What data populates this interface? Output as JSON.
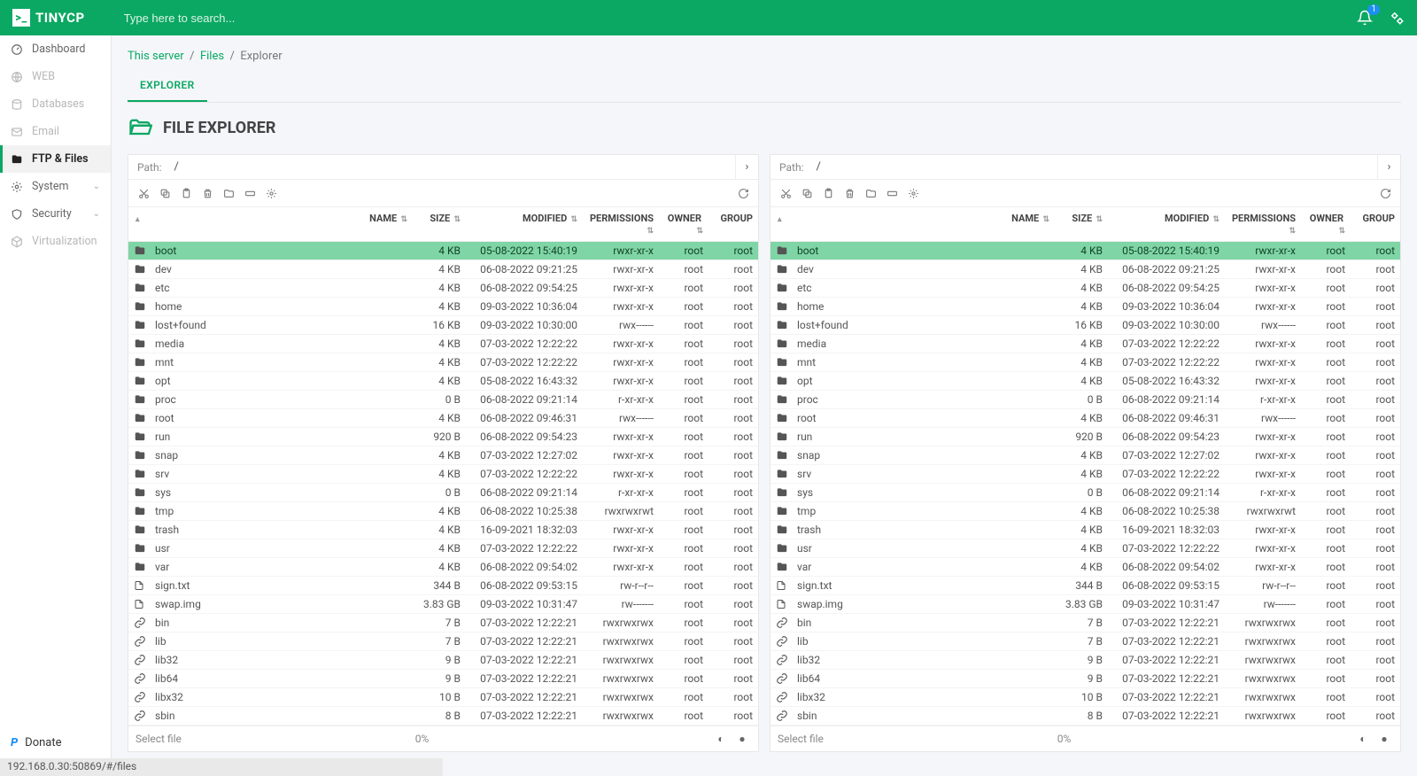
{
  "brand": "TINYCP",
  "search": {
    "placeholder": "Type here to search..."
  },
  "notifications": {
    "count": "1"
  },
  "sidebar": {
    "items": [
      {
        "label": "Dashboard",
        "muted": false,
        "chevron": false,
        "icon": "gauge"
      },
      {
        "label": "WEB",
        "muted": true,
        "chevron": false,
        "icon": "globe"
      },
      {
        "label": "Databases",
        "muted": true,
        "chevron": false,
        "icon": "db"
      },
      {
        "label": "Email",
        "muted": true,
        "chevron": false,
        "icon": "mail"
      },
      {
        "label": "FTP & Files",
        "muted": false,
        "chevron": false,
        "icon": "folder",
        "active": true
      },
      {
        "label": "System",
        "muted": false,
        "chevron": true,
        "icon": "gear"
      },
      {
        "label": "Security",
        "muted": false,
        "chevron": true,
        "icon": "shield"
      },
      {
        "label": "Virtualization",
        "muted": true,
        "chevron": false,
        "icon": "cube"
      }
    ],
    "donate": "Donate"
  },
  "breadcrumb": {
    "server": "This server",
    "files": "Files",
    "current": "Explorer",
    "sep": "/"
  },
  "tab": {
    "explorer": "EXPLORER"
  },
  "title": "FILE EXPLORER",
  "pathLabel": "Path:",
  "headers": {
    "name": "NAME",
    "size": "SIZE",
    "modified": "MODIFIED",
    "permissions": "PERMISSIONS",
    "owner": "OWNER",
    "group": "GROUP"
  },
  "footer": {
    "select": "Select file",
    "pct": "0%"
  },
  "status": "192.168.0.30:50869/#/files",
  "panes": [
    {
      "path": "/"
    },
    {
      "path": "/"
    }
  ],
  "files": [
    {
      "t": "d",
      "name": "boot",
      "size": "4 KB",
      "mod": "05-08-2022 15:40:19",
      "perm": "rwxr-xr-x",
      "own": "root",
      "grp": "root",
      "sel": true
    },
    {
      "t": "d",
      "name": "dev",
      "size": "4 KB",
      "mod": "06-08-2022 09:21:25",
      "perm": "rwxr-xr-x",
      "own": "root",
      "grp": "root"
    },
    {
      "t": "d",
      "name": "etc",
      "size": "4 KB",
      "mod": "06-08-2022 09:54:25",
      "perm": "rwxr-xr-x",
      "own": "root",
      "grp": "root"
    },
    {
      "t": "d",
      "name": "home",
      "size": "4 KB",
      "mod": "09-03-2022 10:36:04",
      "perm": "rwxr-xr-x",
      "own": "root",
      "grp": "root"
    },
    {
      "t": "d",
      "name": "lost+found",
      "size": "16 KB",
      "mod": "09-03-2022 10:30:00",
      "perm": "rwx------",
      "own": "root",
      "grp": "root"
    },
    {
      "t": "d",
      "name": "media",
      "size": "4 KB",
      "mod": "07-03-2022 12:22:22",
      "perm": "rwxr-xr-x",
      "own": "root",
      "grp": "root"
    },
    {
      "t": "d",
      "name": "mnt",
      "size": "4 KB",
      "mod": "07-03-2022 12:22:22",
      "perm": "rwxr-xr-x",
      "own": "root",
      "grp": "root"
    },
    {
      "t": "d",
      "name": "opt",
      "size": "4 KB",
      "mod": "05-08-2022 16:43:32",
      "perm": "rwxr-xr-x",
      "own": "root",
      "grp": "root"
    },
    {
      "t": "d",
      "name": "proc",
      "size": "0 B",
      "mod": "06-08-2022 09:21:14",
      "perm": "r-xr-xr-x",
      "own": "root",
      "grp": "root"
    },
    {
      "t": "d",
      "name": "root",
      "size": "4 KB",
      "mod": "06-08-2022 09:46:31",
      "perm": "rwx------",
      "own": "root",
      "grp": "root"
    },
    {
      "t": "d",
      "name": "run",
      "size": "920 B",
      "mod": "06-08-2022 09:54:23",
      "perm": "rwxr-xr-x",
      "own": "root",
      "grp": "root"
    },
    {
      "t": "d",
      "name": "snap",
      "size": "4 KB",
      "mod": "07-03-2022 12:27:02",
      "perm": "rwxr-xr-x",
      "own": "root",
      "grp": "root"
    },
    {
      "t": "d",
      "name": "srv",
      "size": "4 KB",
      "mod": "07-03-2022 12:22:22",
      "perm": "rwxr-xr-x",
      "own": "root",
      "grp": "root"
    },
    {
      "t": "d",
      "name": "sys",
      "size": "0 B",
      "mod": "06-08-2022 09:21:14",
      "perm": "r-xr-xr-x",
      "own": "root",
      "grp": "root"
    },
    {
      "t": "d",
      "name": "tmp",
      "size": "4 KB",
      "mod": "06-08-2022 10:25:38",
      "perm": "rwxrwxrwt",
      "own": "root",
      "grp": "root"
    },
    {
      "t": "d",
      "name": "trash",
      "size": "4 KB",
      "mod": "16-09-2021 18:32:03",
      "perm": "rwxr-xr-x",
      "own": "root",
      "grp": "root"
    },
    {
      "t": "d",
      "name": "usr",
      "size": "4 KB",
      "mod": "07-03-2022 12:22:22",
      "perm": "rwxr-xr-x",
      "own": "root",
      "grp": "root"
    },
    {
      "t": "d",
      "name": "var",
      "size": "4 KB",
      "mod": "06-08-2022 09:54:02",
      "perm": "rwxr-xr-x",
      "own": "root",
      "grp": "root"
    },
    {
      "t": "f",
      "name": "sign.txt",
      "size": "344 B",
      "mod": "06-08-2022 09:53:15",
      "perm": "rw-r--r--",
      "own": "root",
      "grp": "root"
    },
    {
      "t": "f",
      "name": "swap.img",
      "size": "3.83 GB",
      "mod": "09-03-2022 10:31:47",
      "perm": "rw-------",
      "own": "root",
      "grp": "root"
    },
    {
      "t": "l",
      "name": "bin",
      "size": "7 B",
      "mod": "07-03-2022 12:22:21",
      "perm": "rwxrwxrwx",
      "own": "root",
      "grp": "root"
    },
    {
      "t": "l",
      "name": "lib",
      "size": "7 B",
      "mod": "07-03-2022 12:22:21",
      "perm": "rwxrwxrwx",
      "own": "root",
      "grp": "root"
    },
    {
      "t": "l",
      "name": "lib32",
      "size": "9 B",
      "mod": "07-03-2022 12:22:21",
      "perm": "rwxrwxrwx",
      "own": "root",
      "grp": "root"
    },
    {
      "t": "l",
      "name": "lib64",
      "size": "9 B",
      "mod": "07-03-2022 12:22:21",
      "perm": "rwxrwxrwx",
      "own": "root",
      "grp": "root"
    },
    {
      "t": "l",
      "name": "libx32",
      "size": "10 B",
      "mod": "07-03-2022 12:22:21",
      "perm": "rwxrwxrwx",
      "own": "root",
      "grp": "root"
    },
    {
      "t": "l",
      "name": "sbin",
      "size": "8 B",
      "mod": "07-03-2022 12:22:21",
      "perm": "rwxrwxrwx",
      "own": "root",
      "grp": "root"
    }
  ],
  "toolbarIcons": [
    "cut",
    "copy",
    "paste",
    "delete",
    "newfolder",
    "rename",
    "settings"
  ]
}
